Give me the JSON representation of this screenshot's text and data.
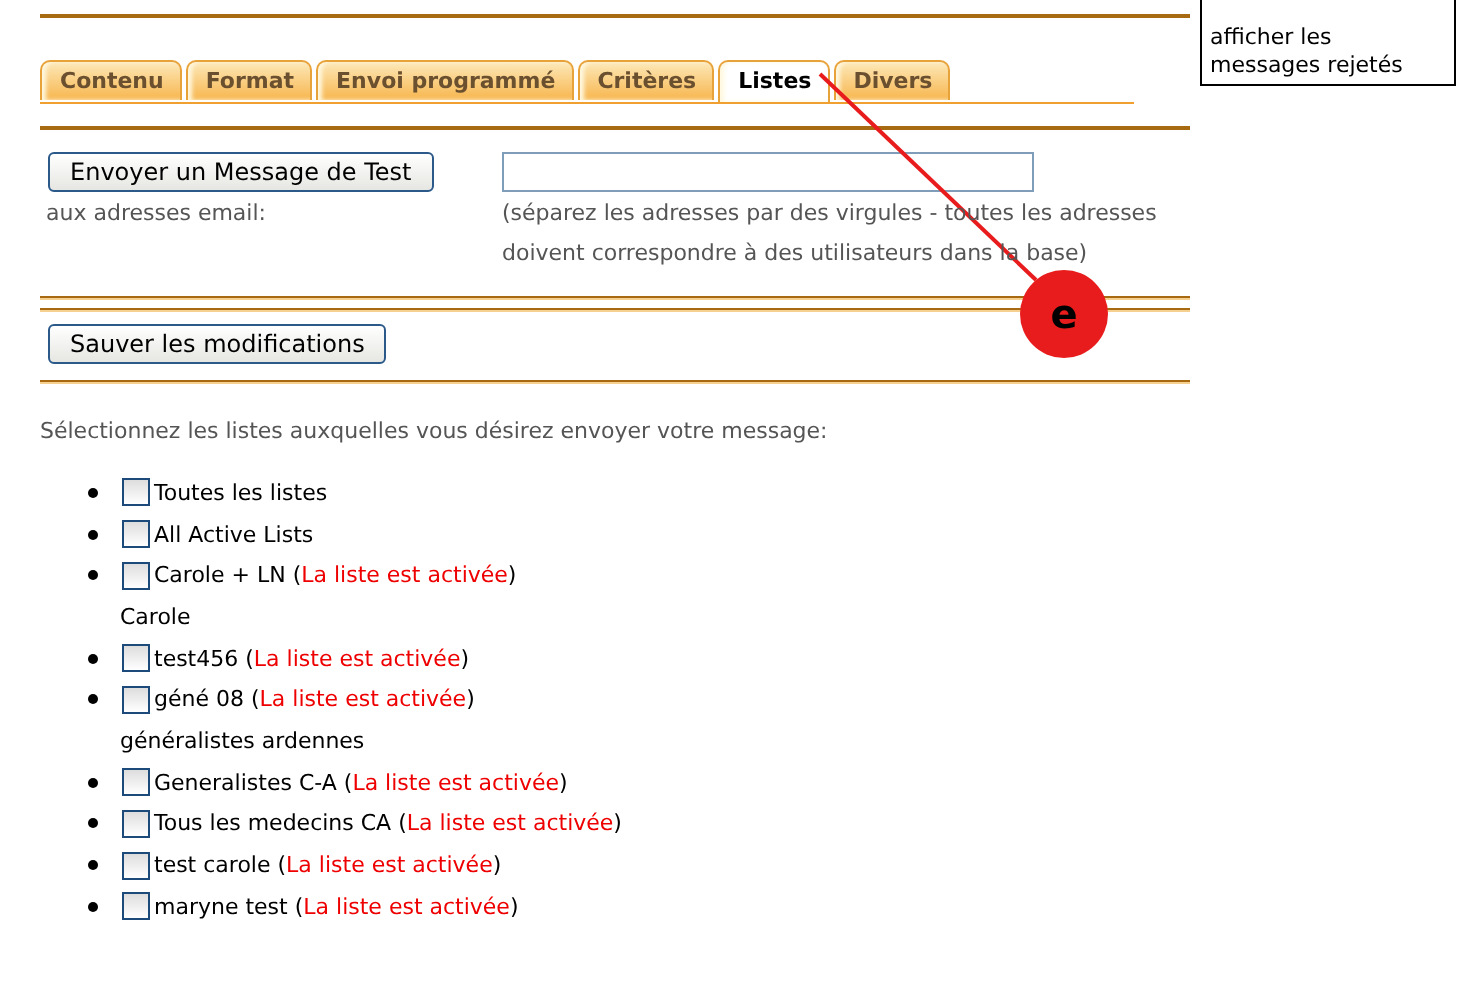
{
  "tabs": [
    {
      "label": "Contenu",
      "selected": false
    },
    {
      "label": "Format",
      "selected": false
    },
    {
      "label": "Envoi programmé",
      "selected": false
    },
    {
      "label": "Critères",
      "selected": false
    },
    {
      "label": "Listes",
      "selected": true
    },
    {
      "label": "Divers",
      "selected": false
    }
  ],
  "test_message": {
    "button": "Envoyer un Message de Test",
    "label": "aux adresses email:",
    "hint": "(séparez les adresses par des virgules - toutes les adresses doivent correspondre à des utilisateurs dans la base)"
  },
  "save_button": "Sauver les modifications",
  "instruction": "Sélectionnez les listes auxquelles vous désirez envoyer votre message:",
  "lists": [
    {
      "kind": "list",
      "name": "Toutes les listes",
      "checked": false
    },
    {
      "kind": "list",
      "name": "All Active Lists",
      "checked": false
    },
    {
      "kind": "list",
      "name": "Carole + LN",
      "open": "(",
      "status": "La liste est activée",
      "close": ")",
      "checked": false
    },
    {
      "kind": "description",
      "name": "Carole"
    },
    {
      "kind": "list",
      "name": "test456",
      "open": "(",
      "status": "La liste est activée",
      "close": ")",
      "checked": false
    },
    {
      "kind": "list",
      "name": "géné 08",
      "open": "(",
      "status": "La liste est activée",
      "close": ")",
      "checked": false
    },
    {
      "kind": "description",
      "name": "généralistes ardennes"
    },
    {
      "kind": "list",
      "name": "Generalistes C-A",
      "open": "(",
      "status": "La liste est activée",
      "close": ")",
      "checked": false
    },
    {
      "kind": "list",
      "name": "Tous les medecins CA",
      "open": "(",
      "status": "La liste est activée",
      "close": ")",
      "checked": false
    },
    {
      "kind": "list",
      "name": "test carole",
      "open": "(",
      "status": "La liste est activée",
      "close": ")",
      "checked": false
    },
    {
      "kind": "list",
      "name": "maryne test",
      "open": "(",
      "status": "La liste est activée",
      "close": ")",
      "checked": false
    }
  ],
  "side_menu": [
    "afficher les messages rejetés"
  ],
  "callout": {
    "label": "e"
  }
}
